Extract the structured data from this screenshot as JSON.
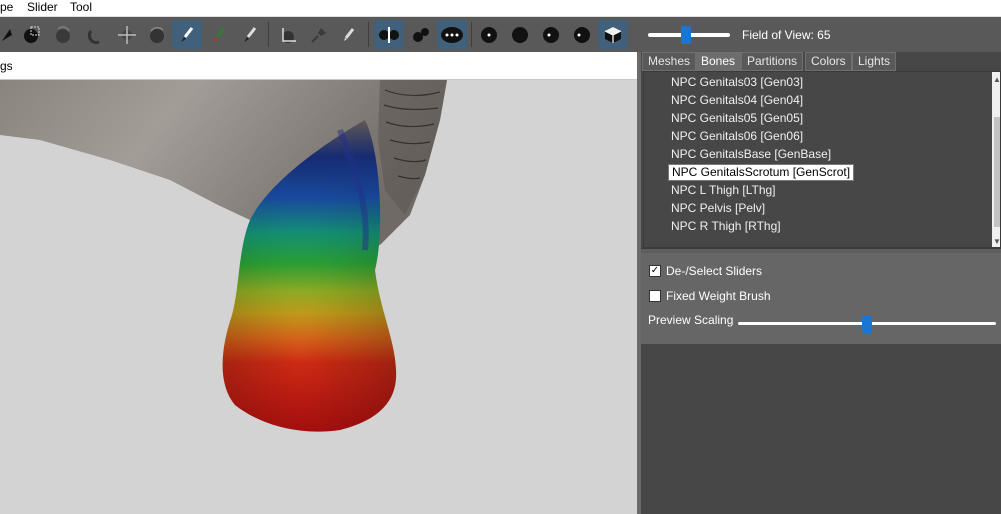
{
  "menu": {
    "items": [
      "pe",
      "Slider",
      "Tool"
    ]
  },
  "toolbar": {
    "buttons": [
      "select-arrow-icon",
      "render-sphere-icon",
      "lasso-select-icon",
      "sphere-icon",
      "smooth-icon",
      "move-icon",
      "rotate-icon",
      "brush-icon",
      "weight-brush-icon",
      "color-brush-icon",
      "transform-icon",
      "pin-icon",
      "pencil-icon",
      "mirror-icon",
      "vertices-icon",
      "dots-icon",
      "circle-dot-icon",
      "black-sphere-icon",
      "half-sphere-icon",
      "sphere-shade-icon",
      "cube-icon"
    ],
    "active": [
      "brush-icon",
      "mirror-icon",
      "dots-icon",
      "cube-icon"
    ]
  },
  "view": {
    "fov_label": "Field of View: 65",
    "fov_fraction": 0.5
  },
  "subbar": {
    "text": "gs"
  },
  "tabs": [
    "Meshes",
    "Bones",
    "Partitions",
    "Colors",
    "Lights"
  ],
  "selected_tab": "Bones",
  "bones": [
    "NPC Genitals03 [Gen03]",
    "NPC Genitals04 [Gen04]",
    "NPC Genitals05 [Gen05]",
    "NPC Genitals06 [Gen06]",
    "NPC GenitalsBase [GenBase]",
    "NPC GenitalsScrotum [GenScrot]",
    "NPC L Thigh [LThg]",
    "NPC Pelvis [Pelv]",
    "NPC R Thigh [RThg]"
  ],
  "selected_bone": "NPC GenitalsScrotum [GenScrot]",
  "options": {
    "deselect_label": "De-/Select Sliders",
    "deselect_checked": true,
    "fixed_weight_label": "Fixed Weight Brush",
    "fixed_weight_checked": false,
    "preview_label": "Preview Scaling",
    "preview_fraction": 0.5
  },
  "colors": {
    "accent": "#1976d2",
    "toolbar": "#595959",
    "panel": "#474747"
  }
}
